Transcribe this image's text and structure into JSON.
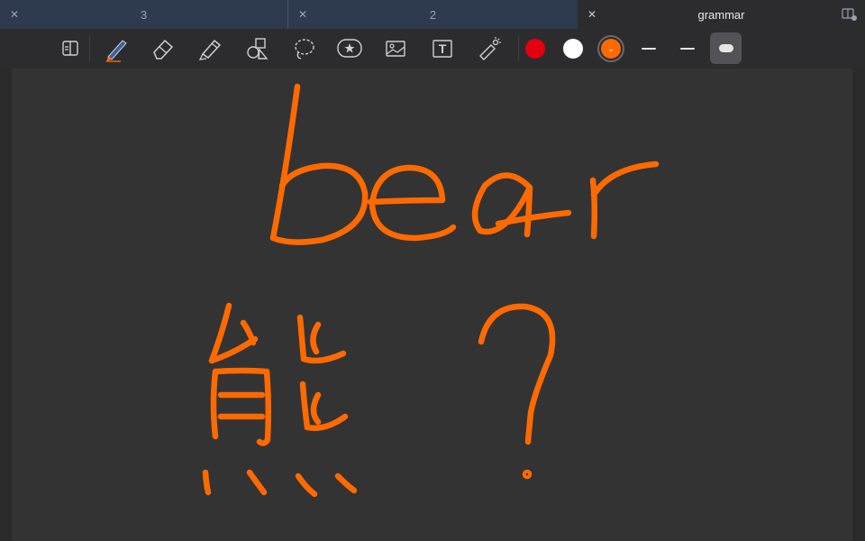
{
  "tabs": [
    {
      "label": "3",
      "active": false
    },
    {
      "label": "2",
      "active": false
    },
    {
      "label": "grammar",
      "active": true
    }
  ],
  "toolbar": {
    "tools": [
      "page-layout-icon",
      "pen-icon",
      "eraser-icon",
      "highlighter-icon",
      "shapes-icon",
      "lasso-icon",
      "sticker-icon",
      "image-icon",
      "text-box-icon",
      "laser-pointer-icon"
    ],
    "text_tool_glyph": "T",
    "colors": [
      {
        "name": "red",
        "hex": "#e3000f"
      },
      {
        "name": "white",
        "hex": "#ffffff"
      },
      {
        "name": "orange",
        "hex": "#ff6a00",
        "selected": true
      }
    ],
    "color_picker_glyph": "⌄",
    "stroke_widths": [
      "thin",
      "medium",
      "thick"
    ],
    "selected_stroke": "thick"
  },
  "canvas": {
    "ink_color": "#ff6a00",
    "handwritten_content": [
      "bear",
      "熊",
      "?"
    ]
  }
}
